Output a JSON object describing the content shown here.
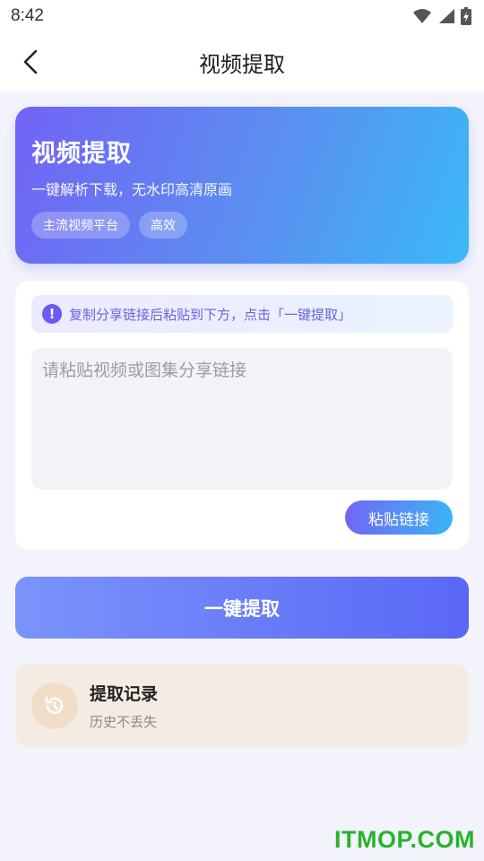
{
  "status_bar": {
    "time": "8:42",
    "icons": [
      "wifi-icon",
      "signal-icon",
      "battery-charging-icon"
    ]
  },
  "app_bar": {
    "title": "视频提取",
    "back_icon": "chevron-left-icon"
  },
  "hero": {
    "title": "视频提取",
    "subtitle": "一键解析下载，无水印高清原画",
    "tags": [
      "主流视频平台",
      "高效"
    ]
  },
  "input_card": {
    "tip": "复制分享链接后粘贴到下方，点击「一键提取」",
    "tip_icon": "exclamation-icon",
    "textarea_value": "",
    "textarea_placeholder": "请粘贴视频或图集分享链接",
    "paste_label": "粘贴链接"
  },
  "extract_button": {
    "label": "一键提取"
  },
  "history": {
    "title": "提取记录",
    "subtitle": "历史不丢失",
    "icon": "history-clock-icon"
  },
  "watermark": "ITMOP.COM",
  "colors": {
    "hero_gradient": [
      "#7263f6",
      "#3ab9f8"
    ],
    "primary_button": [
      "#7b94fb",
      "#5a67f6"
    ],
    "history_bg": "#f4ebe3",
    "watermark": "#27b32c"
  }
}
